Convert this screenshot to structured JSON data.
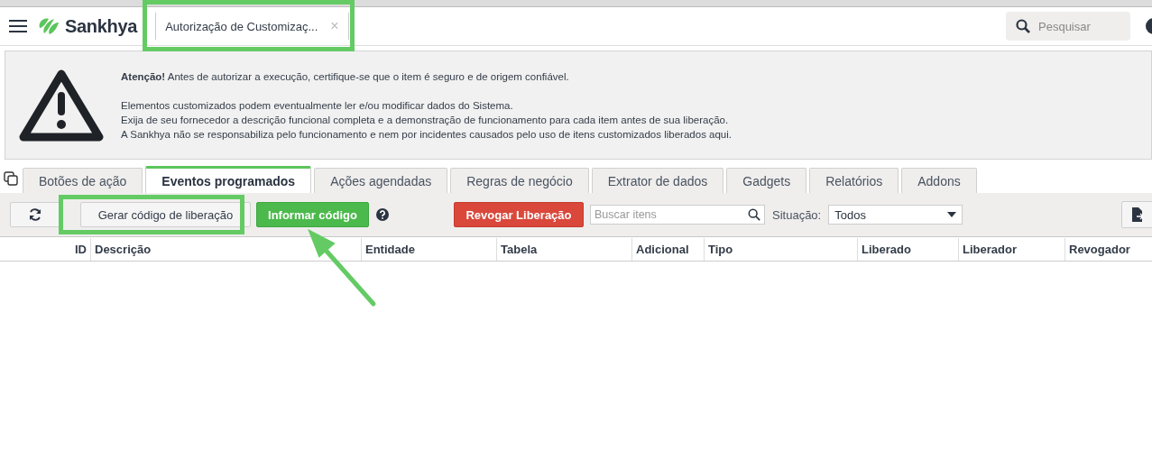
{
  "header": {
    "brand": "Sankhya",
    "open_tab": {
      "label": "Autorização de Customizaç...",
      "close": "×"
    },
    "search": {
      "placeholder": "Pesquisar"
    }
  },
  "warning": {
    "alert": "**Atenção!** Antes de autorizar a execução, certifique-se que o item é seguro e de origem confiável.",
    "lines": [
      "Elementos customizados podem eventualmente ler e/ou modificar dados do Sistema.",
      "Exija de seu fornecedor a descrição funcional completa e a demonstração de funcionamento para cada item antes de sua liberação.",
      "A Sankhya não se responsabiliza pelo funcionamento e nem por incidentes causados pelo uso de itens customizados liberados aqui."
    ]
  },
  "tabs": [
    {
      "label": "Botões de ação",
      "selected": false
    },
    {
      "label": "Eventos programados",
      "selected": true
    },
    {
      "label": "Ações agendadas",
      "selected": false
    },
    {
      "label": "Regras de negócio",
      "selected": false
    },
    {
      "label": "Extrator de dados",
      "selected": false
    },
    {
      "label": "Gadgets",
      "selected": false
    },
    {
      "label": "Relatórios",
      "selected": false
    },
    {
      "label": "Addons",
      "selected": false
    }
  ],
  "toolbar": {
    "generate_button": "Gerar código de liberação",
    "inform_button": "Informar código",
    "revoke_button": "Revogar Liberação",
    "search": {
      "placeholder": "Buscar itens"
    },
    "status_label": "Situação:",
    "status_value": "Todos"
  },
  "table": {
    "columns": [
      "ID",
      "Descrição",
      "Entidade",
      "Tabela",
      "Adicional",
      "Tipo",
      "Liberado",
      "Liberador",
      "Revogador"
    ]
  }
}
